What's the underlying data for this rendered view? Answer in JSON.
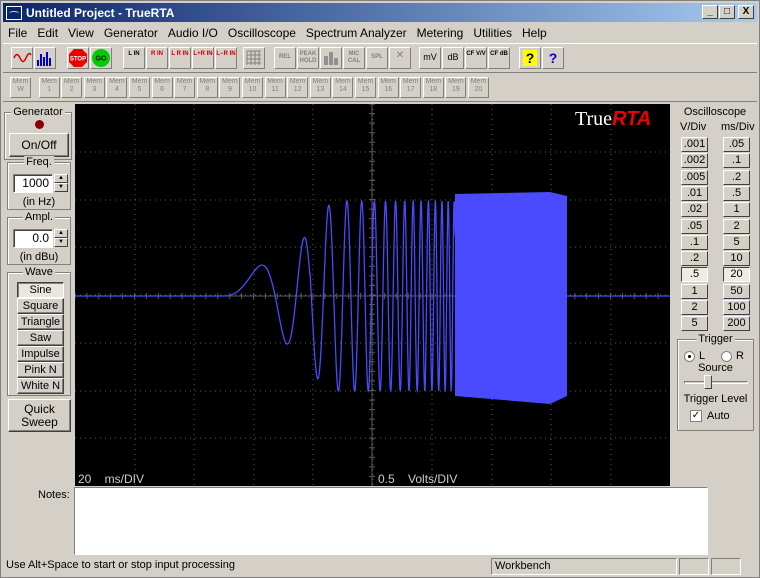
{
  "window": {
    "title": "Untitled Project - TrueRTA",
    "controls": [
      "_",
      "□",
      "X"
    ]
  },
  "menu": [
    {
      "label": "File"
    },
    {
      "label": "Edit"
    },
    {
      "label": "View"
    },
    {
      "label": "Generator"
    },
    {
      "label": "Audio I/O"
    },
    {
      "label": "Oscilloscope"
    },
    {
      "label": "Spectrum Analyzer"
    },
    {
      "label": "Metering"
    },
    {
      "label": "Utilities"
    },
    {
      "label": "Help"
    }
  ],
  "toolbar1": {
    "buttons": [
      {
        "name": "sine-wave-mode-icon"
      },
      {
        "name": "spectrum-mode-icon"
      },
      {
        "name": "stop-button",
        "label": "STOP"
      },
      {
        "name": "go-button",
        "label": "GO"
      },
      {
        "name": "l-in-button",
        "label": "L IN"
      },
      {
        "name": "r-in-button",
        "label": "R IN"
      },
      {
        "name": "l-r-in-button",
        "label": "L R IN"
      },
      {
        "name": "l-plus-r-in-button",
        "label": "L+R IN"
      },
      {
        "name": "l-minus-r-in-button",
        "label": "L−R IN"
      },
      {
        "name": "grid-button"
      },
      {
        "name": "rel-button",
        "label": "REL"
      },
      {
        "name": "peak-hold-button",
        "label": "PEAK HOLD"
      },
      {
        "name": "bar-button"
      },
      {
        "name": "mic-cal-button",
        "label": "MIC CAL"
      },
      {
        "name": "spl-button",
        "label": "SPL"
      },
      {
        "name": "clear-button",
        "label": "✕"
      },
      {
        "name": "mv-button",
        "label": "mV"
      },
      {
        "name": "db-button",
        "label": "dB"
      },
      {
        "name": "cf-vv-button",
        "label": "CF V/V"
      },
      {
        "name": "cf-db-button",
        "label": "CF dB"
      },
      {
        "name": "help-button",
        "label": "?"
      },
      {
        "name": "context-help-button",
        "label": "?"
      }
    ]
  },
  "toolbar2": {
    "mem_label": "Mem",
    "mem_buttons": [
      "W",
      "1",
      "2",
      "3",
      "4",
      "5",
      "6",
      "7",
      "8",
      "9",
      "10",
      "11",
      "12",
      "13",
      "14",
      "15",
      "16",
      "17",
      "18",
      "19",
      "20"
    ]
  },
  "generator": {
    "label": "Generator",
    "onoff": "On/Off",
    "freq_label": "Freq.",
    "freq_value": "1000",
    "freq_unit": "(in Hz)",
    "ampl_label": "Ampl.",
    "ampl_value": "0.0",
    "ampl_unit": "(in dBu)",
    "wave_label": "Wave",
    "waves": [
      "Sine",
      "Square",
      "Triangle",
      "Saw",
      "Impulse",
      "Pink N",
      "White N"
    ],
    "selected_wave": "Sine",
    "quick_sweep": "Quick Sweep"
  },
  "scope": {
    "brand_true": "True",
    "brand_rta": "RTA",
    "time_readout": "20    ms/DIV",
    "volt_readout": "0.5    Volts/DIV",
    "colors": {
      "trace": "#4a4aff",
      "grid": "#5a5a5a",
      "background": "#000000"
    }
  },
  "oscilloscope": {
    "label": "Oscilloscope",
    "vdiv_label": "V/Div",
    "msdiv_label": "ms/Div",
    "vdiv": [
      ".001",
      ".002",
      ".005",
      ".01",
      ".02",
      ".05",
      ".1",
      ".2",
      ".5",
      "1",
      "2",
      "5"
    ],
    "msdiv": [
      ".05",
      ".1",
      ".2",
      ".5",
      "1",
      "2",
      "5",
      "10",
      "20",
      "50",
      "100",
      "200"
    ],
    "selected_vdiv": ".5",
    "selected_msdiv": "20",
    "trigger_label": "Trigger",
    "trigger_l": "L",
    "trigger_r": "R",
    "source_label": "Source",
    "trigger_level_label": "Trigger Level",
    "auto_label": "Auto",
    "trigger_level": 0.35
  },
  "notes": {
    "label": "Notes:",
    "value": ""
  },
  "status": {
    "hint": "Use Alt+Space to start or stop input processing",
    "mode": "Workbench"
  }
}
